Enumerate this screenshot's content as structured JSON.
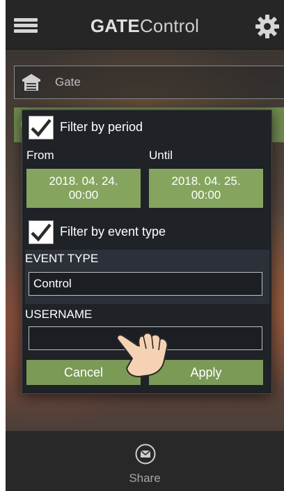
{
  "header": {
    "title_bold": "GATE",
    "title_rest": "Control",
    "menu_icon": "hamburger-menu-icon",
    "settings_icon": "gear-icon"
  },
  "gate_selector": {
    "label": "Gate",
    "icon": "garage-door-icon"
  },
  "dialog": {
    "filter_period": {
      "label": "Filter by period",
      "checked": true
    },
    "from_label": "From",
    "until_label": "Until",
    "from_date": "2018. 04. 24.",
    "from_time": "00:00",
    "until_date": "2018. 04. 25.",
    "until_time": "00:00",
    "filter_event": {
      "label": "Filter by event type",
      "checked": true
    },
    "event_type_label": "EVENT TYPE",
    "event_type_value": "Control",
    "username_label": "USERNAME",
    "username_value": "",
    "cancel_label": "Cancel",
    "apply_label": "Apply"
  },
  "bottom_bar": {
    "share_label": "Share",
    "share_icon": "envelope-icon"
  },
  "colors": {
    "accent_green": "#85a55f",
    "dialog_bg": "#1f2227",
    "topbar_bg": "#262626"
  }
}
